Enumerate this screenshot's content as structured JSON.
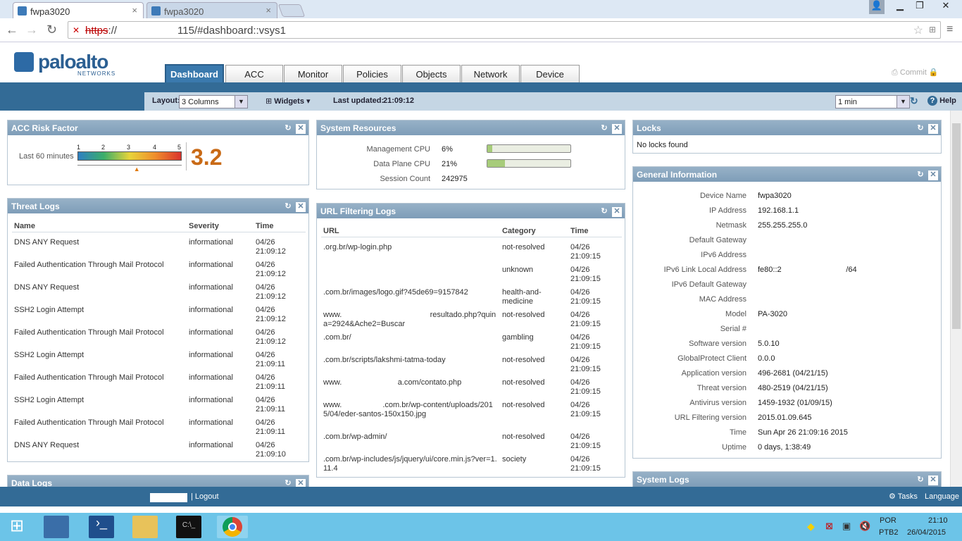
{
  "browser": {
    "tabs": [
      {
        "title": "fwpa3020"
      },
      {
        "title": "fwpa3020"
      }
    ],
    "url_scheme": "https",
    "url_sep": "://",
    "url_rest": "115/#dashboard::vsys1"
  },
  "brand": {
    "name": "paloalto",
    "sub": "NETWORKS"
  },
  "nav": [
    {
      "label": "Dashboard"
    },
    {
      "label": "ACC"
    },
    {
      "label": "Monitor"
    },
    {
      "label": "Policies"
    },
    {
      "label": "Objects"
    },
    {
      "label": "Network"
    },
    {
      "label": "Device"
    }
  ],
  "commit_label": "Commit",
  "toolbar": {
    "layout_label": "Layout:",
    "layout_value": "3 Columns",
    "widgets_label": "Widgets",
    "updated_label": "Last updated:",
    "updated_value": "21:09:12",
    "refresh_value": "1 min",
    "help_label": "Help"
  },
  "acc": {
    "title": "ACC Risk Factor",
    "period": "Last 60 minutes",
    "ticks": [
      "1",
      "2",
      "3",
      "4",
      "5"
    ],
    "value": "3.2",
    "risk_score": 3.2
  },
  "threat": {
    "title": "Threat Logs",
    "cols": [
      "Name",
      "Severity",
      "Time"
    ],
    "rows": [
      {
        "name": "DNS ANY Request",
        "sev": "informational",
        "date": "04/26",
        "time": "21:09:12"
      },
      {
        "name": "Failed Authentication Through Mail Protocol",
        "sev": "informational",
        "date": "04/26",
        "time": "21:09:12"
      },
      {
        "name": "DNS ANY Request",
        "sev": "informational",
        "date": "04/26",
        "time": "21:09:12"
      },
      {
        "name": "SSH2 Login Attempt",
        "sev": "informational",
        "date": "04/26",
        "time": "21:09:12"
      },
      {
        "name": "Failed Authentication Through Mail Protocol",
        "sev": "informational",
        "date": "04/26",
        "time": "21:09:12"
      },
      {
        "name": "SSH2 Login Attempt",
        "sev": "informational",
        "date": "04/26",
        "time": "21:09:11"
      },
      {
        "name": "Failed Authentication Through Mail Protocol",
        "sev": "informational",
        "date": "04/26",
        "time": "21:09:11"
      },
      {
        "name": "SSH2 Login Attempt",
        "sev": "informational",
        "date": "04/26",
        "time": "21:09:11"
      },
      {
        "name": "Failed Authentication Through Mail Protocol",
        "sev": "informational",
        "date": "04/26",
        "time": "21:09:11"
      },
      {
        "name": "DNS ANY Request",
        "sev": "informational",
        "date": "04/26",
        "time": "21:09:10"
      }
    ]
  },
  "datalogs": {
    "title": "Data Logs"
  },
  "sysres": {
    "title": "System Resources",
    "mgmt_label": "Management CPU",
    "mgmt_value": "6%",
    "mgmt_pct": 6,
    "dp_label": "Data Plane CPU",
    "dp_value": "21%",
    "dp_pct": 21,
    "sess_label": "Session Count",
    "sess_value": "242975"
  },
  "url": {
    "title": "URL Filtering Logs",
    "cols": [
      "URL",
      "Category",
      "Time"
    ],
    "rows": [
      {
        "url": ".org.br/wp-login.php",
        "cat": "not-resolved",
        "date": "04/26",
        "time": "21:09:15"
      },
      {
        "url": "",
        "cat": "unknown",
        "date": "04/26",
        "time": "21:09:15"
      },
      {
        "url": ".com.br/images/logo.gif?45de69=9157842",
        "cat": "health-and-medicine",
        "date": "04/26",
        "time": "21:09:15"
      },
      {
        "url": "www.                                         resultado.php?quina=2924&Ache2=Buscar",
        "cat": "not-resolved",
        "date": "04/26",
        "time": "21:09:15"
      },
      {
        "url": ".com.br/",
        "cat": "gambling",
        "date": "04/26",
        "time": "21:09:15"
      },
      {
        "url": ".com.br/scripts/lakshmi-tatma-today",
        "cat": "not-resolved",
        "date": "04/26",
        "time": "21:09:15"
      },
      {
        "url": "www.                          a.com/contato.php",
        "cat": "not-resolved",
        "date": "04/26",
        "time": "21:09:15"
      },
      {
        "url": "www.                   .com.br/wp-content/uploads/2015/04/eder-santos-150x150.jpg",
        "cat": "not-resolved",
        "date": "04/26",
        "time": "21:09:15"
      },
      {
        "url": ".com.br/wp-admin/",
        "cat": "not-resolved",
        "date": "04/26",
        "time": "21:09:15"
      },
      {
        "url": ".com.br/wp-includes/js/jquery/ui/core.min.js?ver=1.11.4",
        "cat": "society",
        "date": "04/26",
        "time": "21:09:15"
      }
    ]
  },
  "locks": {
    "title": "Locks",
    "msg": "No locks found"
  },
  "geninfo": {
    "title": "General Information",
    "items": [
      {
        "k": "Device Name",
        "v": "fwpa3020"
      },
      {
        "k": "IP Address",
        "v": "192.168.1.1"
      },
      {
        "k": "Netmask",
        "v": "255.255.255.0"
      },
      {
        "k": "Default Gateway",
        "v": ""
      },
      {
        "k": "IPv6 Address",
        "v": ""
      },
      {
        "k": "IPv6 Link Local Address",
        "v": "fe80::2                              /64"
      },
      {
        "k": "IPv6 Default Gateway",
        "v": ""
      },
      {
        "k": "MAC Address",
        "v": ""
      },
      {
        "k": "Model",
        "v": "PA-3020"
      },
      {
        "k": "Serial #",
        "v": ""
      },
      {
        "k": "Software version",
        "v": "5.0.10"
      },
      {
        "k": "GlobalProtect Client",
        "v": "0.0.0"
      },
      {
        "k": "Application version",
        "v": "496-2681 (04/21/15)"
      },
      {
        "k": "Threat version",
        "v": "480-2519 (04/21/15)"
      },
      {
        "k": "Antivirus version",
        "v": "1459-1932 (01/09/15)"
      },
      {
        "k": "URL Filtering version",
        "v": "2015.01.09.645"
      },
      {
        "k": "Time",
        "v": "Sun Apr 26 21:09:16 2015"
      },
      {
        "k": "Uptime",
        "v": "0 days, 1:38:49"
      }
    ]
  },
  "syslogs": {
    "title": "System Logs"
  },
  "status": {
    "logout": "| Logout",
    "tasks": "Tasks",
    "language": "Language"
  },
  "taskbar": {
    "lang1": "POR",
    "lang2": "PTB2",
    "time": "21:10",
    "date": "26/04/2015"
  }
}
